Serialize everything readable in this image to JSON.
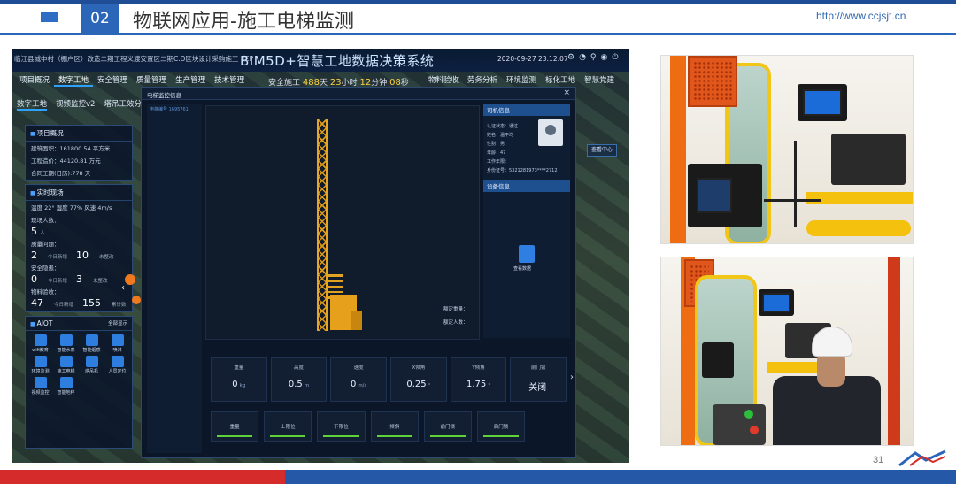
{
  "slide": {
    "section_number": "02",
    "title": "物联网应用-施工电梯监测",
    "url": "http://www.ccjsjt.cn",
    "page_number": "31",
    "colors": {
      "header_blue": "#2b66b8",
      "footer_red": "#d62b2b",
      "footer_blue": "#2559a7"
    }
  },
  "dashboard": {
    "project_address": "临江县城中村（棚户区）改造二期工程义渡安置区二期C.D区块设计采购施工（EP",
    "system_title": "BIM5D+智慧工地数据决策系统",
    "datetime": "2020-09-27 23:12:07",
    "safety": {
      "prefix": "安全施工",
      "days": "488",
      "days_unit": "天",
      "hours": "23",
      "hours_unit": "小时",
      "minutes": "12",
      "minutes_unit": "分钟",
      "seconds": "08",
      "seconds_unit": "秒"
    },
    "nav_left": [
      "项目概况",
      "数字工地",
      "安全管理",
      "质量管理",
      "生产管理",
      "技术管理"
    ],
    "nav_right": [
      "物料验收",
      "劳务分析",
      "环境监测",
      "标化工地",
      "智慧党建"
    ],
    "sub_nav": [
      "数字工地",
      "视频监控v2",
      "塔吊工效分析"
    ],
    "project_panel": {
      "title": "项目概况",
      "area": "建筑面积：161800.54 平方米",
      "cost": "工程造价：44120.81 万元",
      "period": "合同工期(日历):778 天"
    },
    "live_panel": {
      "title": "实时现场",
      "weather": "温度 22°   湿度 77%   风速 4m/s",
      "workers_label": "现场人数：",
      "workers": "5",
      "workers_unit": "人",
      "quality_label": "质量问题：",
      "quality_today": "2",
      "quality_today_unit": "今日新增",
      "quality_open": "10",
      "quality_open_unit": "未整改",
      "safety_label": "安全隐患：",
      "safety_today": "0",
      "safety_today_unit": "今日新增",
      "safety_open": "3",
      "safety_open_unit": "未整改",
      "material_label": "物料验收：",
      "material_today": "47",
      "material_today_unit": "今日新增",
      "material_total": "155",
      "material_total_unit": "累计数"
    },
    "aiot_panel": {
      "title": "AIOT",
      "toggle_label": "全部显示",
      "items": [
        "wifi教育",
        "智能水表",
        "智能烟感",
        "喷淋",
        "环境监测",
        "施工电梯",
        "塔吊机",
        "人员定位",
        "视频监控",
        "智能地秤"
      ]
    },
    "float_button": "查看中心",
    "modal": {
      "title": "电梯监控信息",
      "side_label": "电梯编号 1695761",
      "driver_header": "司机信息",
      "driver_lines": [
        "认证状态：通过",
        "姓名：温平均",
        "性别：男",
        "年龄：47",
        "工作年限：",
        "身份证号：5321281973****2712"
      ],
      "device_header": "设备信息",
      "device_label": "查看数据",
      "view_labels": {
        "rated_load": "额定重量：",
        "rated_people": "额定人数："
      },
      "metrics": [
        {
          "label": "重量",
          "value": "0",
          "unit": "kg"
        },
        {
          "label": "高度",
          "value": "0.5",
          "unit": "m"
        },
        {
          "label": "速度",
          "value": "0",
          "unit": "m/s"
        },
        {
          "label": "X倾角",
          "value": "0.25",
          "unit": "°"
        },
        {
          "label": "Y倾角",
          "value": "1.75",
          "unit": "°"
        },
        {
          "label": "前门锁",
          "value": "关闭",
          "unit": ""
        }
      ],
      "statuses": [
        "重量",
        "上限位",
        "下限位",
        "倾斜",
        "前门锁",
        "后门锁"
      ]
    }
  }
}
